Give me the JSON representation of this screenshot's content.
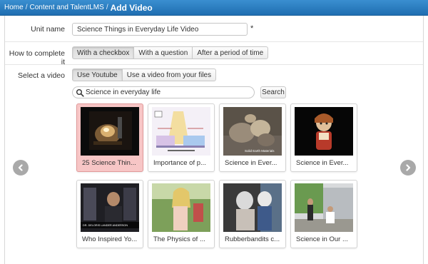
{
  "breadcrumb": {
    "items": [
      "Home",
      "Content and TalentLMS"
    ],
    "separator": "/",
    "current": "Add Video"
  },
  "form": {
    "unit_name_label": "Unit name",
    "unit_name_value": "Science Things in Everyday Life Video",
    "required_mark": "*",
    "complete_label": "How to complete it",
    "complete_options": [
      "With a checkbox",
      "With a question",
      "After a period of time"
    ],
    "complete_selected": "With a checkbox",
    "video_label": "Select a video",
    "video_source_options": [
      "Use Youtube",
      "Use a video from your files"
    ],
    "video_source_selected": "Use Youtube",
    "search_value": "Science in everyday life",
    "search_button": "Search"
  },
  "videos": [
    {
      "caption": "25 Science Thin...",
      "selected": true
    },
    {
      "caption": "Importance of p...",
      "selected": false
    },
    {
      "caption": "Science in Ever...",
      "selected": false
    },
    {
      "caption": "Science in Ever...",
      "selected": false
    },
    {
      "caption": "Who Inspired Yo...",
      "selected": false
    },
    {
      "caption": "The Physics of ...",
      "selected": false
    },
    {
      "caption": "Rubberbandits c...",
      "selected": false
    },
    {
      "caption": "Science in Our ...",
      "selected": false
    }
  ],
  "thumb_text": {
    "solid_earth": "Solid Earth Materials",
    "lower_third": "DR. DELORIS LANDER ANDERSON"
  },
  "colors": {
    "topbar": "#1f6eb1",
    "selected_card": "#f7c6c6",
    "arrow": "#a9a9a9"
  },
  "icons": {
    "prev": "chevron-left-icon",
    "next": "chevron-right-icon",
    "search": "magnifier-icon"
  }
}
